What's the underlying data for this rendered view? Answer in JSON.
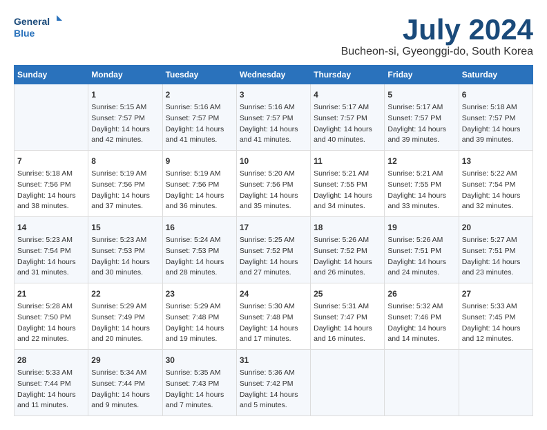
{
  "logo": {
    "line1": "General",
    "line2": "Blue"
  },
  "title": "July 2024",
  "subtitle": "Bucheon-si, Gyeonggi-do, South Korea",
  "header": {
    "days": [
      "Sunday",
      "Monday",
      "Tuesday",
      "Wednesday",
      "Thursday",
      "Friday",
      "Saturday"
    ]
  },
  "weeks": [
    {
      "cells": [
        {
          "day": "",
          "content": ""
        },
        {
          "day": "1",
          "content": "Sunrise: 5:15 AM\nSunset: 7:57 PM\nDaylight: 14 hours\nand 42 minutes."
        },
        {
          "day": "2",
          "content": "Sunrise: 5:16 AM\nSunset: 7:57 PM\nDaylight: 14 hours\nand 41 minutes."
        },
        {
          "day": "3",
          "content": "Sunrise: 5:16 AM\nSunset: 7:57 PM\nDaylight: 14 hours\nand 41 minutes."
        },
        {
          "day": "4",
          "content": "Sunrise: 5:17 AM\nSunset: 7:57 PM\nDaylight: 14 hours\nand 40 minutes."
        },
        {
          "day": "5",
          "content": "Sunrise: 5:17 AM\nSunset: 7:57 PM\nDaylight: 14 hours\nand 39 minutes."
        },
        {
          "day": "6",
          "content": "Sunrise: 5:18 AM\nSunset: 7:57 PM\nDaylight: 14 hours\nand 39 minutes."
        }
      ]
    },
    {
      "cells": [
        {
          "day": "7",
          "content": "Sunrise: 5:18 AM\nSunset: 7:56 PM\nDaylight: 14 hours\nand 38 minutes."
        },
        {
          "day": "8",
          "content": "Sunrise: 5:19 AM\nSunset: 7:56 PM\nDaylight: 14 hours\nand 37 minutes."
        },
        {
          "day": "9",
          "content": "Sunrise: 5:19 AM\nSunset: 7:56 PM\nDaylight: 14 hours\nand 36 minutes."
        },
        {
          "day": "10",
          "content": "Sunrise: 5:20 AM\nSunset: 7:56 PM\nDaylight: 14 hours\nand 35 minutes."
        },
        {
          "day": "11",
          "content": "Sunrise: 5:21 AM\nSunset: 7:55 PM\nDaylight: 14 hours\nand 34 minutes."
        },
        {
          "day": "12",
          "content": "Sunrise: 5:21 AM\nSunset: 7:55 PM\nDaylight: 14 hours\nand 33 minutes."
        },
        {
          "day": "13",
          "content": "Sunrise: 5:22 AM\nSunset: 7:54 PM\nDaylight: 14 hours\nand 32 minutes."
        }
      ]
    },
    {
      "cells": [
        {
          "day": "14",
          "content": "Sunrise: 5:23 AM\nSunset: 7:54 PM\nDaylight: 14 hours\nand 31 minutes."
        },
        {
          "day": "15",
          "content": "Sunrise: 5:23 AM\nSunset: 7:53 PM\nDaylight: 14 hours\nand 30 minutes."
        },
        {
          "day": "16",
          "content": "Sunrise: 5:24 AM\nSunset: 7:53 PM\nDaylight: 14 hours\nand 28 minutes."
        },
        {
          "day": "17",
          "content": "Sunrise: 5:25 AM\nSunset: 7:52 PM\nDaylight: 14 hours\nand 27 minutes."
        },
        {
          "day": "18",
          "content": "Sunrise: 5:26 AM\nSunset: 7:52 PM\nDaylight: 14 hours\nand 26 minutes."
        },
        {
          "day": "19",
          "content": "Sunrise: 5:26 AM\nSunset: 7:51 PM\nDaylight: 14 hours\nand 24 minutes."
        },
        {
          "day": "20",
          "content": "Sunrise: 5:27 AM\nSunset: 7:51 PM\nDaylight: 14 hours\nand 23 minutes."
        }
      ]
    },
    {
      "cells": [
        {
          "day": "21",
          "content": "Sunrise: 5:28 AM\nSunset: 7:50 PM\nDaylight: 14 hours\nand 22 minutes."
        },
        {
          "day": "22",
          "content": "Sunrise: 5:29 AM\nSunset: 7:49 PM\nDaylight: 14 hours\nand 20 minutes."
        },
        {
          "day": "23",
          "content": "Sunrise: 5:29 AM\nSunset: 7:48 PM\nDaylight: 14 hours\nand 19 minutes."
        },
        {
          "day": "24",
          "content": "Sunrise: 5:30 AM\nSunset: 7:48 PM\nDaylight: 14 hours\nand 17 minutes."
        },
        {
          "day": "25",
          "content": "Sunrise: 5:31 AM\nSunset: 7:47 PM\nDaylight: 14 hours\nand 16 minutes."
        },
        {
          "day": "26",
          "content": "Sunrise: 5:32 AM\nSunset: 7:46 PM\nDaylight: 14 hours\nand 14 minutes."
        },
        {
          "day": "27",
          "content": "Sunrise: 5:33 AM\nSunset: 7:45 PM\nDaylight: 14 hours\nand 12 minutes."
        }
      ]
    },
    {
      "cells": [
        {
          "day": "28",
          "content": "Sunrise: 5:33 AM\nSunset: 7:44 PM\nDaylight: 14 hours\nand 11 minutes."
        },
        {
          "day": "29",
          "content": "Sunrise: 5:34 AM\nSunset: 7:44 PM\nDaylight: 14 hours\nand 9 minutes."
        },
        {
          "day": "30",
          "content": "Sunrise: 5:35 AM\nSunset: 7:43 PM\nDaylight: 14 hours\nand 7 minutes."
        },
        {
          "day": "31",
          "content": "Sunrise: 5:36 AM\nSunset: 7:42 PM\nDaylight: 14 hours\nand 5 minutes."
        },
        {
          "day": "",
          "content": ""
        },
        {
          "day": "",
          "content": ""
        },
        {
          "day": "",
          "content": ""
        }
      ]
    }
  ]
}
